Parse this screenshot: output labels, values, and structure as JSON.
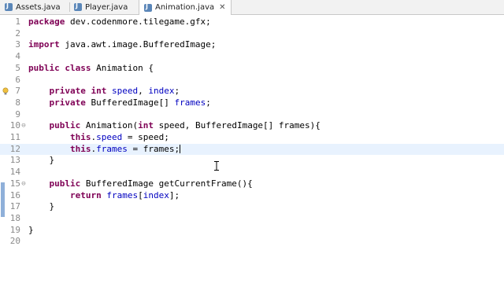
{
  "tabs": [
    {
      "label": "Assets.java"
    },
    {
      "label": "Player.java"
    },
    {
      "label": "Animation.java",
      "close": "✕"
    }
  ],
  "colors": {
    "keyword": "#7f0055",
    "field": "#0000c0",
    "current_line": "#e8f2fe"
  },
  "lines": [
    {
      "n": "1",
      "tokens": [
        {
          "t": "package",
          "c": "kw"
        },
        {
          "t": " dev.codenmore.tilegame.gfx;"
        }
      ]
    },
    {
      "n": "2",
      "tokens": []
    },
    {
      "n": "3",
      "tokens": [
        {
          "t": "import",
          "c": "kw"
        },
        {
          "t": " java.awt.image.BufferedImage;"
        }
      ]
    },
    {
      "n": "4",
      "tokens": []
    },
    {
      "n": "5",
      "tokens": [
        {
          "t": "public",
          "c": "kw"
        },
        {
          "t": " "
        },
        {
          "t": "class",
          "c": "kw"
        },
        {
          "t": " Animation {"
        }
      ]
    },
    {
      "n": "6",
      "tokens": []
    },
    {
      "n": "7",
      "tokens": [
        {
          "t": "    "
        },
        {
          "t": "private",
          "c": "kw"
        },
        {
          "t": " "
        },
        {
          "t": "int",
          "c": "kw"
        },
        {
          "t": " "
        },
        {
          "t": "speed",
          "c": "fld"
        },
        {
          "t": ", "
        },
        {
          "t": "index",
          "c": "fld"
        },
        {
          "t": ";"
        }
      ]
    },
    {
      "n": "8",
      "tokens": [
        {
          "t": "    "
        },
        {
          "t": "private",
          "c": "kw"
        },
        {
          "t": " BufferedImage[] "
        },
        {
          "t": "frames",
          "c": "fld"
        },
        {
          "t": ";"
        }
      ]
    },
    {
      "n": "9",
      "tokens": []
    },
    {
      "n": "10",
      "fold": "⊖",
      "tokens": [
        {
          "t": "    "
        },
        {
          "t": "public",
          "c": "kw"
        },
        {
          "t": " Animation("
        },
        {
          "t": "int",
          "c": "kw"
        },
        {
          "t": " speed, BufferedImage[] frames){"
        }
      ]
    },
    {
      "n": "11",
      "tokens": [
        {
          "t": "        "
        },
        {
          "t": "this",
          "c": "kw"
        },
        {
          "t": "."
        },
        {
          "t": "speed",
          "c": "fld"
        },
        {
          "t": " = speed;"
        }
      ]
    },
    {
      "n": "12",
      "current": true,
      "tokens": [
        {
          "t": "        "
        },
        {
          "t": "this",
          "c": "kw"
        },
        {
          "t": "."
        },
        {
          "t": "frames",
          "c": "fld"
        },
        {
          "t": " = frames;"
        }
      ]
    },
    {
      "n": "13",
      "tokens": [
        {
          "t": "    }"
        }
      ]
    },
    {
      "n": "14",
      "tokens": []
    },
    {
      "n": "15",
      "fold": "⊖",
      "tokens": [
        {
          "t": "    "
        },
        {
          "t": "public",
          "c": "kw"
        },
        {
          "t": " BufferedImage getCurrentFrame(){"
        }
      ]
    },
    {
      "n": "16",
      "tokens": [
        {
          "t": "        "
        },
        {
          "t": "return",
          "c": "kw"
        },
        {
          "t": " "
        },
        {
          "t": "frames",
          "c": "fld"
        },
        {
          "t": "["
        },
        {
          "t": "index",
          "c": "fld"
        },
        {
          "t": "];"
        }
      ]
    },
    {
      "n": "17",
      "tokens": [
        {
          "t": "    }"
        }
      ]
    },
    {
      "n": "18",
      "tokens": []
    },
    {
      "n": "19",
      "tokens": [
        {
          "t": "}"
        }
      ]
    },
    {
      "n": "20",
      "tokens": []
    }
  ]
}
